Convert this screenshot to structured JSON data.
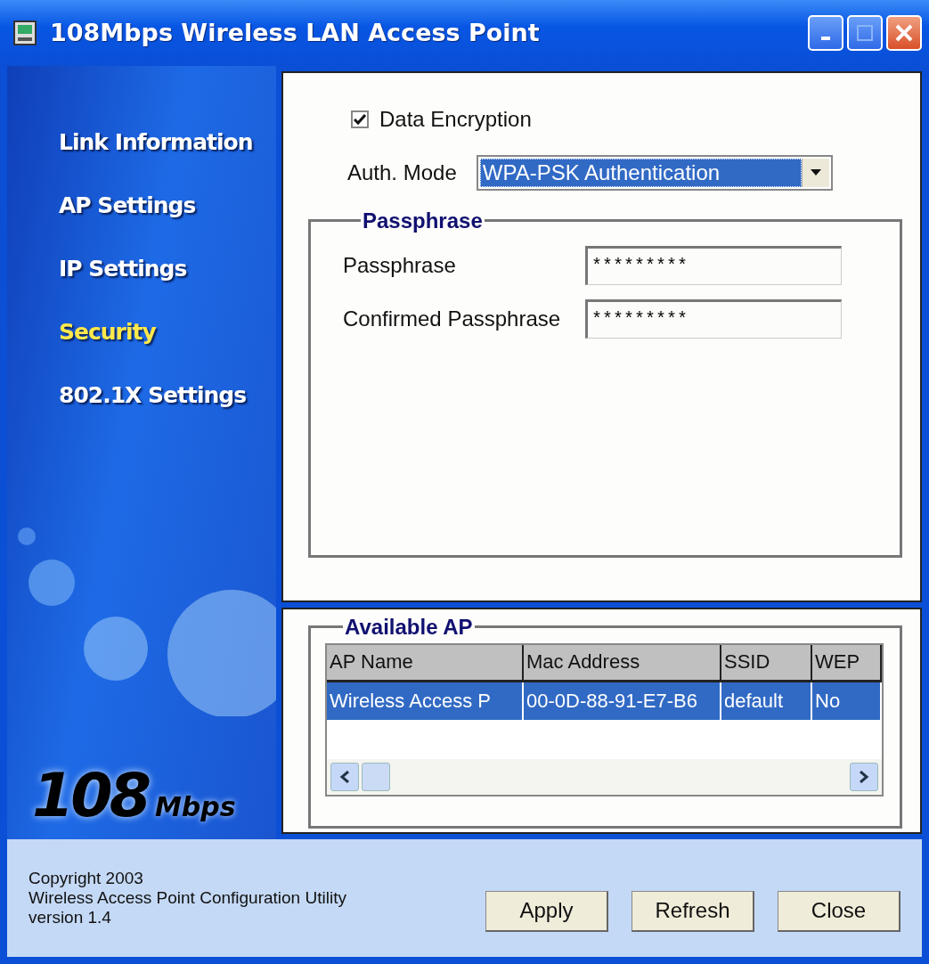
{
  "window": {
    "title": "108Mbps Wireless LAN Access Point"
  },
  "sidebar": {
    "items": [
      {
        "label": "Link Information",
        "selected": false
      },
      {
        "label": "AP Settings",
        "selected": false
      },
      {
        "label": "IP Settings",
        "selected": false
      },
      {
        "label": "Security",
        "selected": true
      },
      {
        "label": "802.1X Settings",
        "selected": false
      }
    ],
    "logo": {
      "number": "108",
      "unit": "Mbps"
    }
  },
  "security": {
    "data_encryption": {
      "label": "Data Encryption",
      "checked": true
    },
    "auth_mode": {
      "label": "Auth. Mode",
      "value": "WPA-PSK Authentication"
    },
    "passphrase_group": {
      "title": "Passphrase",
      "fields": [
        {
          "label": "Passphrase",
          "value": "*********"
        },
        {
          "label": "Confirmed Passphrase",
          "value": "*********"
        }
      ]
    }
  },
  "available_ap": {
    "title": "Available AP",
    "columns": [
      "AP Name",
      "Mac Address",
      "SSID",
      "WEP"
    ],
    "rows": [
      {
        "cells": [
          "Wireless Access P",
          "00-0D-88-91-E7-B6",
          "default",
          "No"
        ],
        "selected": true
      }
    ]
  },
  "footer": {
    "lines": [
      "Copyright 2003",
      "Wireless Access Point Configuration Utility",
      "version 1.4"
    ],
    "buttons": [
      "Apply",
      "Refresh",
      "Close"
    ]
  }
}
